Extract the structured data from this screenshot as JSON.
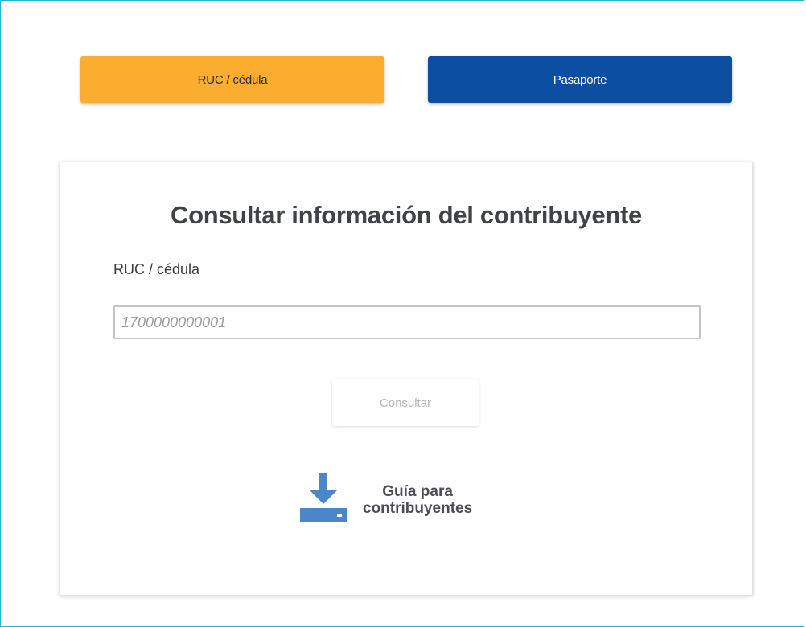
{
  "tabs": {
    "ruc_label": "RUC / cédula",
    "pasaporte_label": "Pasaporte"
  },
  "form": {
    "title": "Consultar información del contribuyente",
    "field_label": "RUC / cédula",
    "input_placeholder": "1700000000001",
    "input_value": "",
    "submit_label": "Consultar"
  },
  "guide": {
    "line1": "Guía para",
    "line2": "contribuyentes",
    "icon": "download-icon"
  },
  "colors": {
    "ruc_tab": "#fbad2f",
    "pasaporte_tab": "#0b4ea2",
    "frame_border": "#1fb6d6",
    "icon_blue": "#4a86c8"
  }
}
